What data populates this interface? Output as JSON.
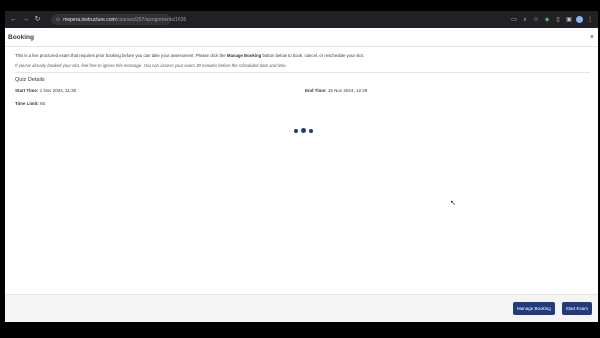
{
  "browser": {
    "url_host": "mepera.instructure.com",
    "url_path": "/courses/297/assignments/1635"
  },
  "modal": {
    "title": "Booking",
    "close_label": "×"
  },
  "content": {
    "intro_pre": "This is a live proctored exam that requires prior booking before you can take your assessment. Please click the ",
    "intro_bold": "Manage Booking",
    "intro_post": " button below to book, cancel, or reschedule your slot.",
    "note": "If you've already booked your slot, feel free to ignore this message. You can access your exam 30 minutes before the scheduled date and time.",
    "section_title": "Quiz Details",
    "start_label": "Start Time:",
    "start_value": " 1 Nov 2024, 11:30",
    "end_label": "End Time:",
    "end_value": " 15 Nov 2024, 12:29",
    "limit_label": "Time Limit:",
    "limit_value": " 60"
  },
  "footer": {
    "manage_label": "Manage Booking",
    "start_label": "Start Exam"
  },
  "colors": {
    "primary": "#213b7e",
    "text": "#2d3b45"
  },
  "icons": [
    "back-icon",
    "forward-icon",
    "reload-icon",
    "site-info-icon",
    "install-icon",
    "zoom-icon",
    "star-icon",
    "extension-icon",
    "sidebar-icon",
    "profile-icon",
    "menu-icon",
    "loading-dots",
    "cursor-icon"
  ]
}
